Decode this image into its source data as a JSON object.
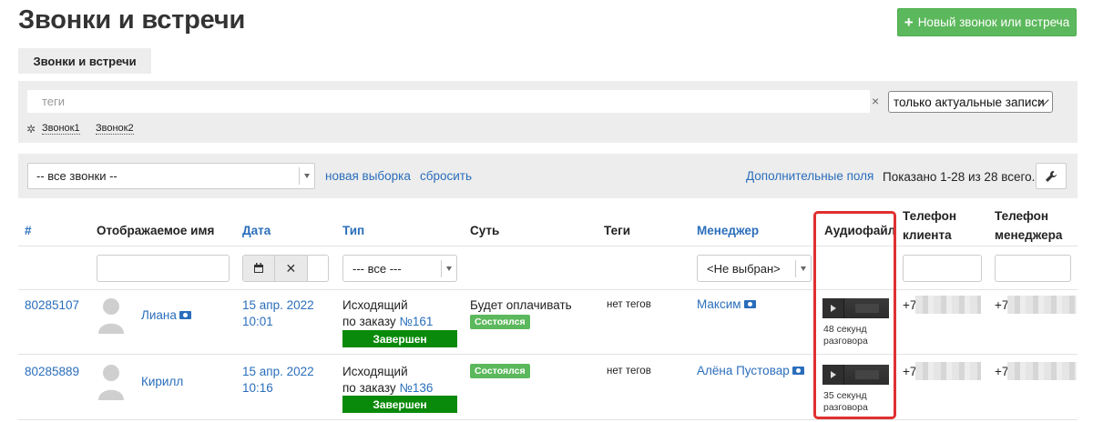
{
  "header": {
    "title": "Звонки и встречи",
    "new_button": "Новый звонок или встреча"
  },
  "tabs": [
    {
      "label": "Звонки и встречи"
    }
  ],
  "tag_filter": {
    "placeholder": "теги",
    "clear": "×",
    "mode_select": "только актуальные записи",
    "tags": [
      "Звонок1",
      "Звонок2"
    ]
  },
  "toolbar": {
    "calls_select": "-- все звонки --",
    "new_selection": "новая выборка",
    "reset": "сбросить",
    "extra_fields": "Дополнительные поля",
    "shown": "Показано 1-28 из 28 всего."
  },
  "table": {
    "columns": {
      "id": "#",
      "name": "Отображаемое имя",
      "date": "Дата",
      "type": "Тип",
      "essence": "Суть",
      "tags": "Теги",
      "manager": "Менеджер",
      "audio": "Аудиофайл",
      "client_phone_1": "Телефон",
      "client_phone_2": "клиента",
      "manager_phone_1": "Телефон",
      "manager_phone_2": "менеджера"
    },
    "filters": {
      "type": "--- все ---",
      "manager": "<Не выбран>"
    },
    "rows": [
      {
        "id": "80285107",
        "name": "Лиана",
        "date": "15 апр. 2022",
        "time": "10:01",
        "type": "Исходящий",
        "order_prefix": "по заказу ",
        "order_link": "№161",
        "status": "Завершен",
        "essence": "Будет оплачивать",
        "badge": "Состоялся",
        "tags": "нет тегов",
        "manager": "Максим",
        "duration_1": "48 секунд",
        "duration_2": "разговора",
        "client_phone": "+7",
        "manager_phone": "+7"
      },
      {
        "id": "80285889",
        "name": "Кирилл",
        "date": "15 апр. 2022",
        "time": "10:16",
        "type": "Исходящий",
        "order_prefix": "по заказу ",
        "order_link": "№136",
        "status": "Завершен",
        "essence": "",
        "badge": "Состоялся",
        "tags": "нет тегов",
        "manager": "Алёна Пустовар",
        "duration_1": "35 секунд",
        "duration_2": "разговора",
        "client_phone": "+7",
        "manager_phone": "+7"
      }
    ]
  },
  "colors": {
    "accent": "#2a6ebb",
    "success": "#5cb85c",
    "status_done": "#0a8a0a",
    "highlight": "#e03030"
  }
}
